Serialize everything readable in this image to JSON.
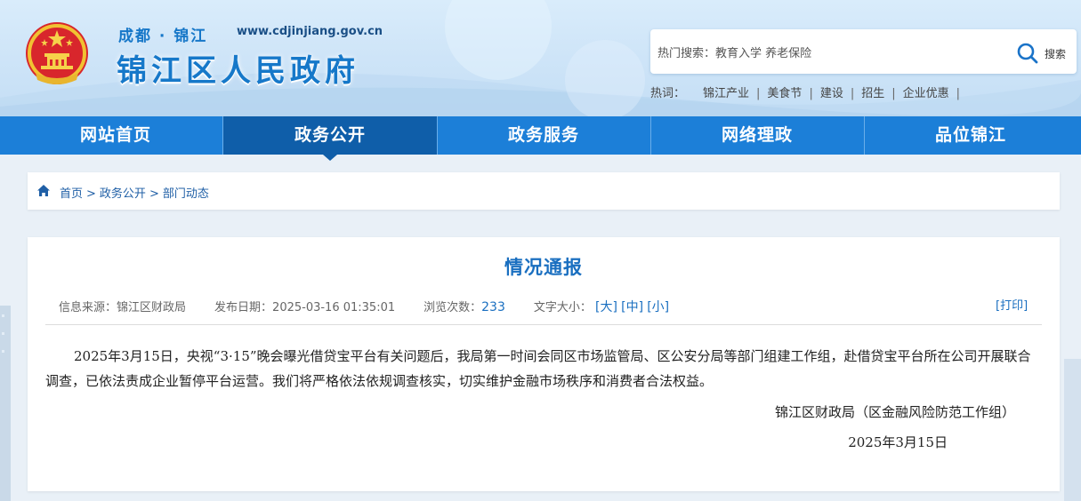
{
  "header": {
    "city": "成都 · 锦江",
    "url": "www.cdjinjiang.gov.cn",
    "site_name": "锦江区人民政府"
  },
  "search": {
    "placeholder": "热门搜索：教育入学 养老保险",
    "button_label": "搜索"
  },
  "hotwords": {
    "label": "热词：",
    "items": [
      "锦江产业",
      "美食节",
      "建设",
      "招生",
      "企业优惠"
    ]
  },
  "nav": {
    "items": [
      "网站首页",
      "政务公开",
      "政务服务",
      "网络理政",
      "品位锦江"
    ],
    "active_index": 1
  },
  "breadcrumb": [
    "首页",
    "政务公开",
    "部门动态"
  ],
  "article": {
    "title": "情况通报",
    "source_label": "信息来源：",
    "source": "锦江区财政局",
    "date_label": "发布日期：",
    "date": "2025-03-16 01:35:01",
    "views_label": "浏览次数：",
    "views": "233",
    "fontsize_label": "文字大小：",
    "font_large": "[大]",
    "font_medium": "[中]",
    "font_small": "[小]",
    "print_label": "[打印]",
    "body": "2025年3月15日，央视“3·15”晚会曝光借贷宝平台有关问题后，我局第一时间会同区市场监管局、区公安分局等部门组建工作组，赴借贷宝平台所在公司开展联合调查，已依法责成企业暂停平台运营。我们将严格依法依规调查核实，切实维护金融市场秩序和消费者合法权益。",
    "signature": "锦江区财政局（区金融风险防范工作组）",
    "sign_date": "2025年3月15日"
  },
  "colors": {
    "nav_bg": "#1c7fd8",
    "nav_active": "#0f5ea9",
    "accent": "#1a6fc0"
  }
}
